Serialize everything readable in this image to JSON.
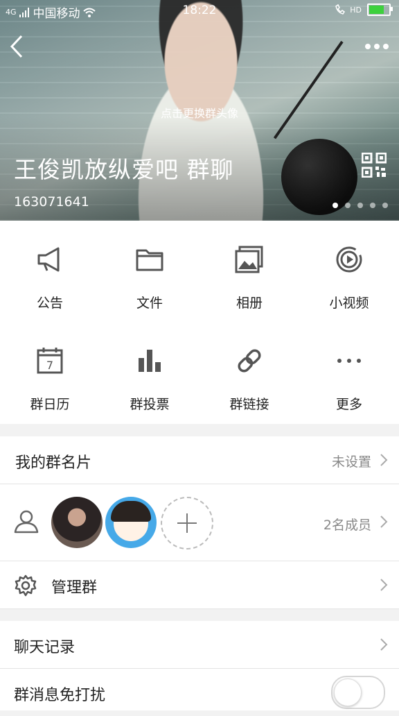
{
  "status_bar": {
    "signal": "4G",
    "carrier": "中国移动",
    "time": "18:22",
    "hd": "HD"
  },
  "header": {
    "change_avatar_hint": "点击更换群头像",
    "group_name": "王俊凯放纵爱吧 群聊",
    "group_id": "163071641",
    "page_dots_count": 5,
    "active_dot": 1
  },
  "features": [
    {
      "label": "公告",
      "icon": "megaphone-icon"
    },
    {
      "label": "文件",
      "icon": "folder-icon"
    },
    {
      "label": "相册",
      "icon": "photo-album-icon"
    },
    {
      "label": "小视频",
      "icon": "play-circle-icon"
    },
    {
      "label": "群日历",
      "icon": "calendar-icon"
    },
    {
      "label": "群投票",
      "icon": "bar-chart-icon"
    },
    {
      "label": "群链接",
      "icon": "link-icon"
    },
    {
      "label": "更多",
      "icon": "more-icon"
    }
  ],
  "calendar_day": "7",
  "rows": {
    "group_card": {
      "title": "我的群名片",
      "value": "未设置"
    },
    "members": {
      "value": "2名成员"
    },
    "manage": {
      "title": "管理群"
    },
    "history": {
      "title": "聊天记录"
    },
    "mute": {
      "title": "群消息免打扰",
      "enabled": false
    }
  }
}
